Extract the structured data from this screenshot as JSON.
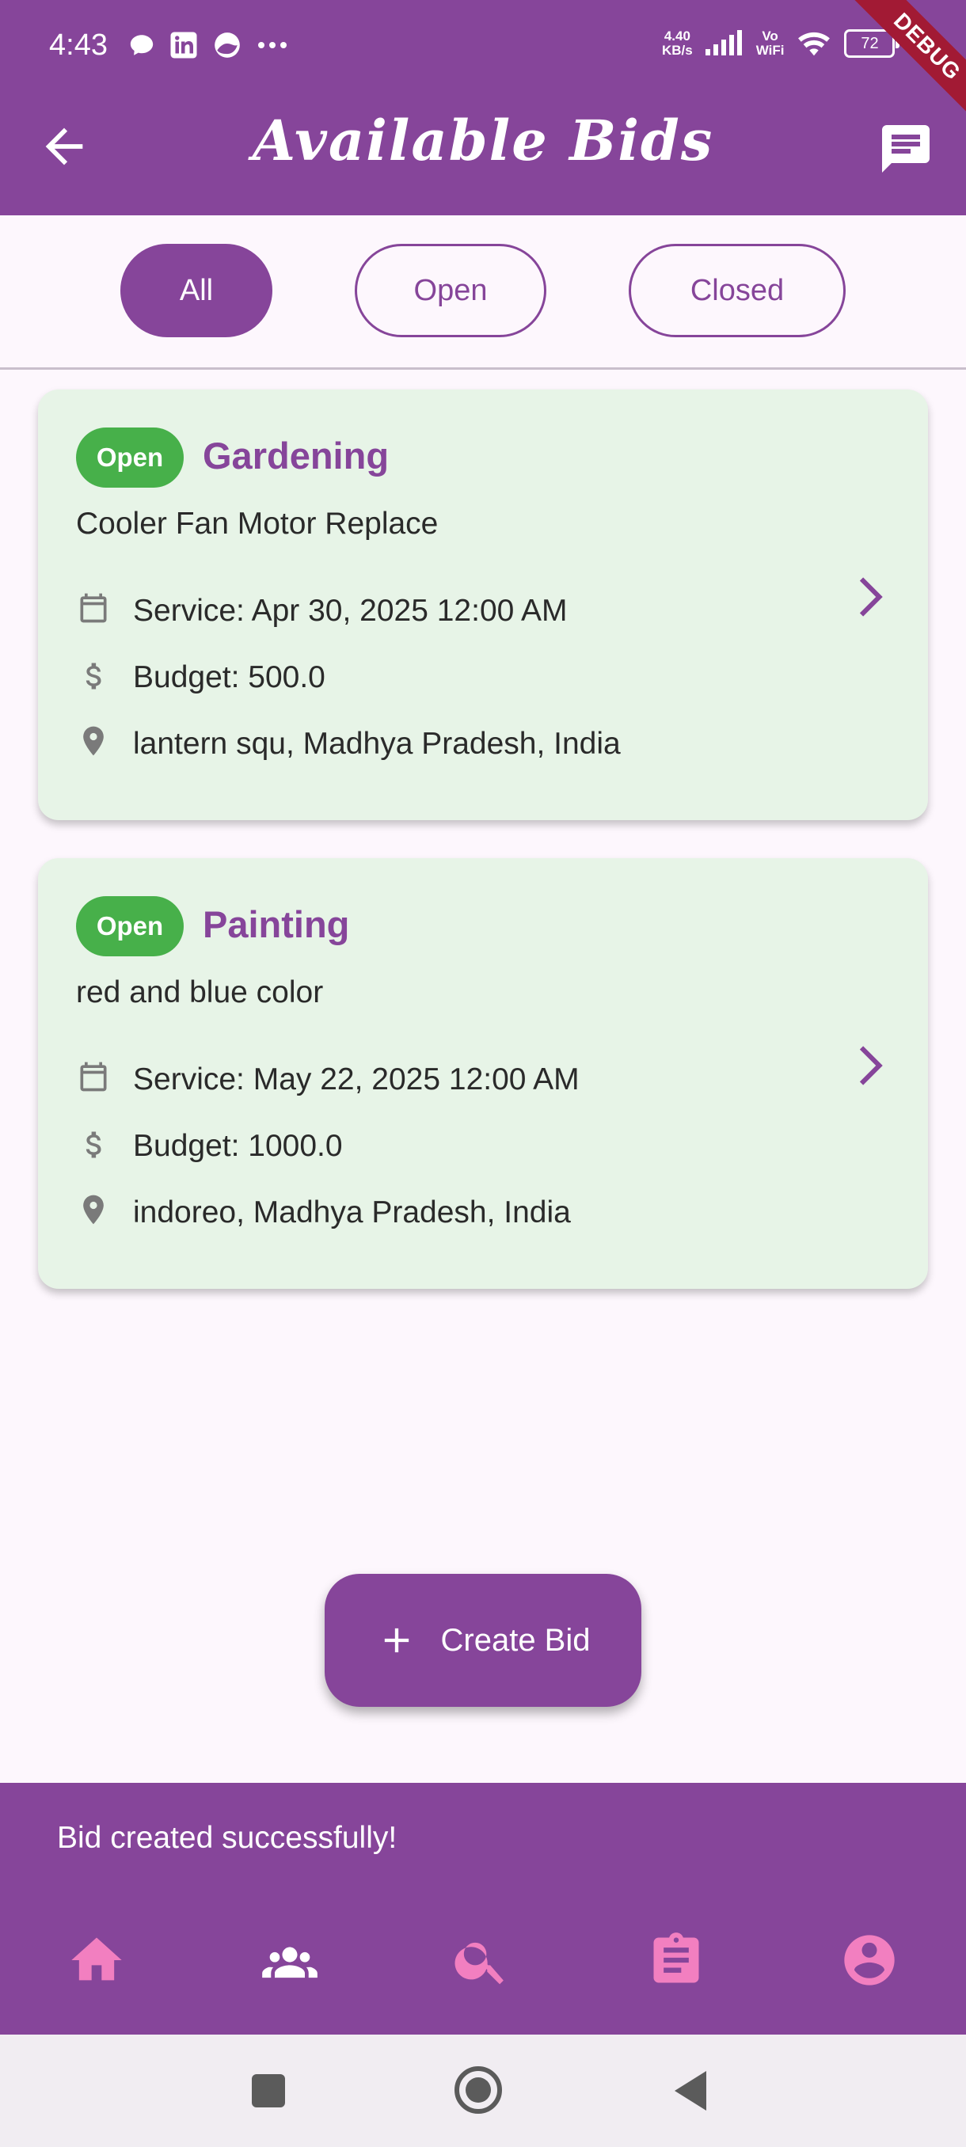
{
  "status_bar": {
    "time": "4:43",
    "network_speed_top": "4.40",
    "network_speed_bottom": "KB/s",
    "volte_top": "Vo",
    "volte_bottom": "WiFi",
    "battery": "72",
    "debug_label": "DEBUG"
  },
  "app_bar": {
    "title": "Available Bids",
    "back_icon": "arrow-back-icon",
    "chat_icon": "chat-icon"
  },
  "filters": [
    {
      "label": "All",
      "active": true
    },
    {
      "label": "Open",
      "active": false
    },
    {
      "label": "Closed",
      "active": false
    }
  ],
  "bids": [
    {
      "status": "Open",
      "category": "Gardening",
      "description": "Cooler Fan Motor Replace",
      "service": "Service: Apr 30, 2025 12:00 AM",
      "budget": "Budget: 500.0",
      "location": "lantern squ, Madhya Pradesh, India"
    },
    {
      "status": "Open",
      "category": "Painting",
      "description": "red and blue color",
      "service": "Service: May 22, 2025 12:00 AM",
      "budget": "Budget: 1000.0",
      "location": "indoreo, Madhya Pradesh, India"
    }
  ],
  "fab": {
    "label": "Create Bid",
    "icon": "plus-icon"
  },
  "snackbar": {
    "message": "Bid created successfully!"
  },
  "bottom_nav": [
    "home-icon",
    "group-icon",
    "search-icon",
    "assignment-icon",
    "account-icon"
  ],
  "colors": {
    "primary": "#86459a",
    "badge_green": "#47b04a",
    "card_bg": "#e7f4e7",
    "nav_icon_pink": "#f27fc0"
  }
}
